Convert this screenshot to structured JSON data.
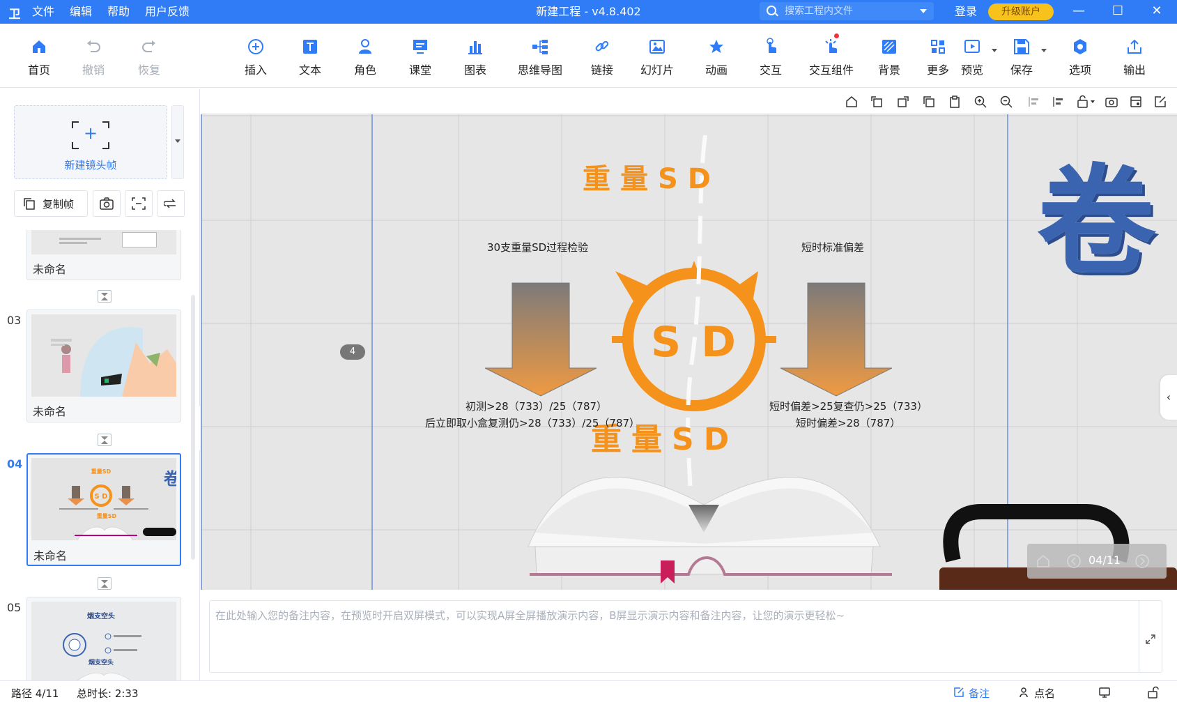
{
  "app": {
    "logo_glyph": "卫",
    "title": "新建工程 - v4.8.402",
    "menu": [
      "文件",
      "编辑",
      "帮助",
      "用户反馈"
    ],
    "search_placeholder": "搜索工程内文件",
    "login": "登录",
    "upgrade": "升级账户",
    "accent_color": "#2f7cf6"
  },
  "toolbar": {
    "items": [
      {
        "label": "首页",
        "icon": "home-icon",
        "enabled": true
      },
      {
        "label": "撤销",
        "icon": "undo-icon",
        "enabled": false
      },
      {
        "label": "恢复",
        "icon": "redo-icon",
        "enabled": false
      },
      {
        "label": "插入",
        "icon": "plus-circle-icon",
        "enabled": true
      },
      {
        "label": "文本",
        "icon": "text-icon",
        "enabled": true
      },
      {
        "label": "角色",
        "icon": "person-icon",
        "enabled": true
      },
      {
        "label": "课堂",
        "icon": "classroom-icon",
        "enabled": true
      },
      {
        "label": "图表",
        "icon": "bar-chart-icon",
        "enabled": true
      },
      {
        "label": "思维导图",
        "icon": "mindmap-icon",
        "enabled": true
      },
      {
        "label": "链接",
        "icon": "link-icon",
        "enabled": true
      },
      {
        "label": "幻灯片",
        "icon": "slides-icon",
        "enabled": true
      },
      {
        "label": "动画",
        "icon": "star-icon",
        "enabled": true
      },
      {
        "label": "交互",
        "icon": "hand-icon",
        "enabled": true
      },
      {
        "label": "交互组件",
        "icon": "click-icon",
        "enabled": true
      },
      {
        "label": "背景",
        "icon": "background-icon",
        "enabled": true
      },
      {
        "label": "更多",
        "icon": "grid-icon",
        "enabled": true
      },
      {
        "label": "预览",
        "icon": "play-icon",
        "enabled": true
      },
      {
        "label": "保存",
        "icon": "save-icon",
        "enabled": true
      },
      {
        "label": "选项",
        "icon": "settings-icon",
        "enabled": true
      },
      {
        "label": "输出",
        "icon": "export-icon",
        "enabled": true
      }
    ]
  },
  "left": {
    "new_frame": "新建镜头帧",
    "copy_frame": "复制帧",
    "slides": [
      {
        "number": "",
        "name": "未命名"
      },
      {
        "number": "03",
        "name": "未命名"
      },
      {
        "number": "04",
        "name": "未命名",
        "active": true
      },
      {
        "number": "05",
        "name": "",
        "thumb_title": "烟支空头",
        "thumb_title2": "烟支空头"
      }
    ],
    "thumb04": {
      "title_top": "重量SD",
      "title_bottom": "重量SD",
      "badge": "卷"
    }
  },
  "canvas": {
    "title_top": "重量SD",
    "title_bottom": "重量SD",
    "center_text": "S D",
    "left_label": "30支重量SD过程检验",
    "right_label": "短时标准偏差",
    "left_text_1": "初测>28（733）/25（787）",
    "left_text_2": "后立即取小盒复测仍>28（733）/25（787）",
    "right_text_1": "短时偏差>25复查仍>25（733）",
    "right_text_2": "短时偏差>28（787）",
    "big_char": "卷",
    "marker": "4",
    "page_indicator": "04/11",
    "orange": "#f5921b",
    "blue_char": "#3a63b0"
  },
  "notes": {
    "placeholder": "在此处输入您的备注内容，在预览时开启双屏模式，可以实现A屏全屏播放演示内容，B屏显示演示内容和备注内容，让您的演示更轻松~"
  },
  "status": {
    "path": "路径 4/11",
    "duration": "总时长: 2:33",
    "notes_btn": "备注",
    "rollcall_btn": "点名"
  }
}
